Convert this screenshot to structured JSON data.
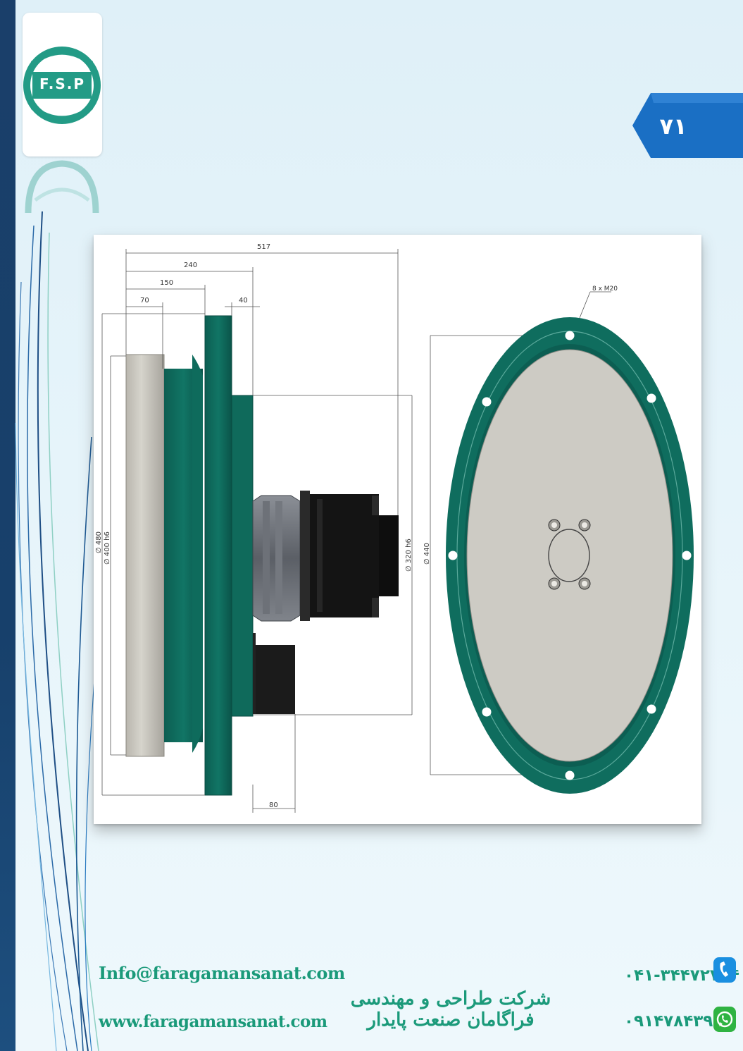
{
  "header": {
    "logo_text": "F.S.P",
    "page_number": "۷۱"
  },
  "drawing": {
    "dimensions_top": [
      "517",
      "240",
      "150",
      "70",
      "40"
    ],
    "dimension_bottom": "80",
    "diameters": {
      "d480": "∅ 480",
      "d400": "∅ 400 h6",
      "d320": "∅ 320 h6",
      "d440": "∅ 440"
    },
    "bolt_note": "8 x M20"
  },
  "footer": {
    "email": "Info@faragamansanat.com",
    "website": "www.faragamansanat.com",
    "company_name": "شرکت طراحی و مهندسی فراگامان صنعت پایدار",
    "phone": "۰۴۱-۳۴۴۷۲۷۴۴",
    "mobile": "۰۹۱۴۷۸۴۳۹۱۹"
  },
  "colors": {
    "brand_teal": "#1b9a7a",
    "housing_teal": "#0e6b5c",
    "tab_blue": "#1a6fc4",
    "sidebar_navy": "#1a3f6a"
  }
}
